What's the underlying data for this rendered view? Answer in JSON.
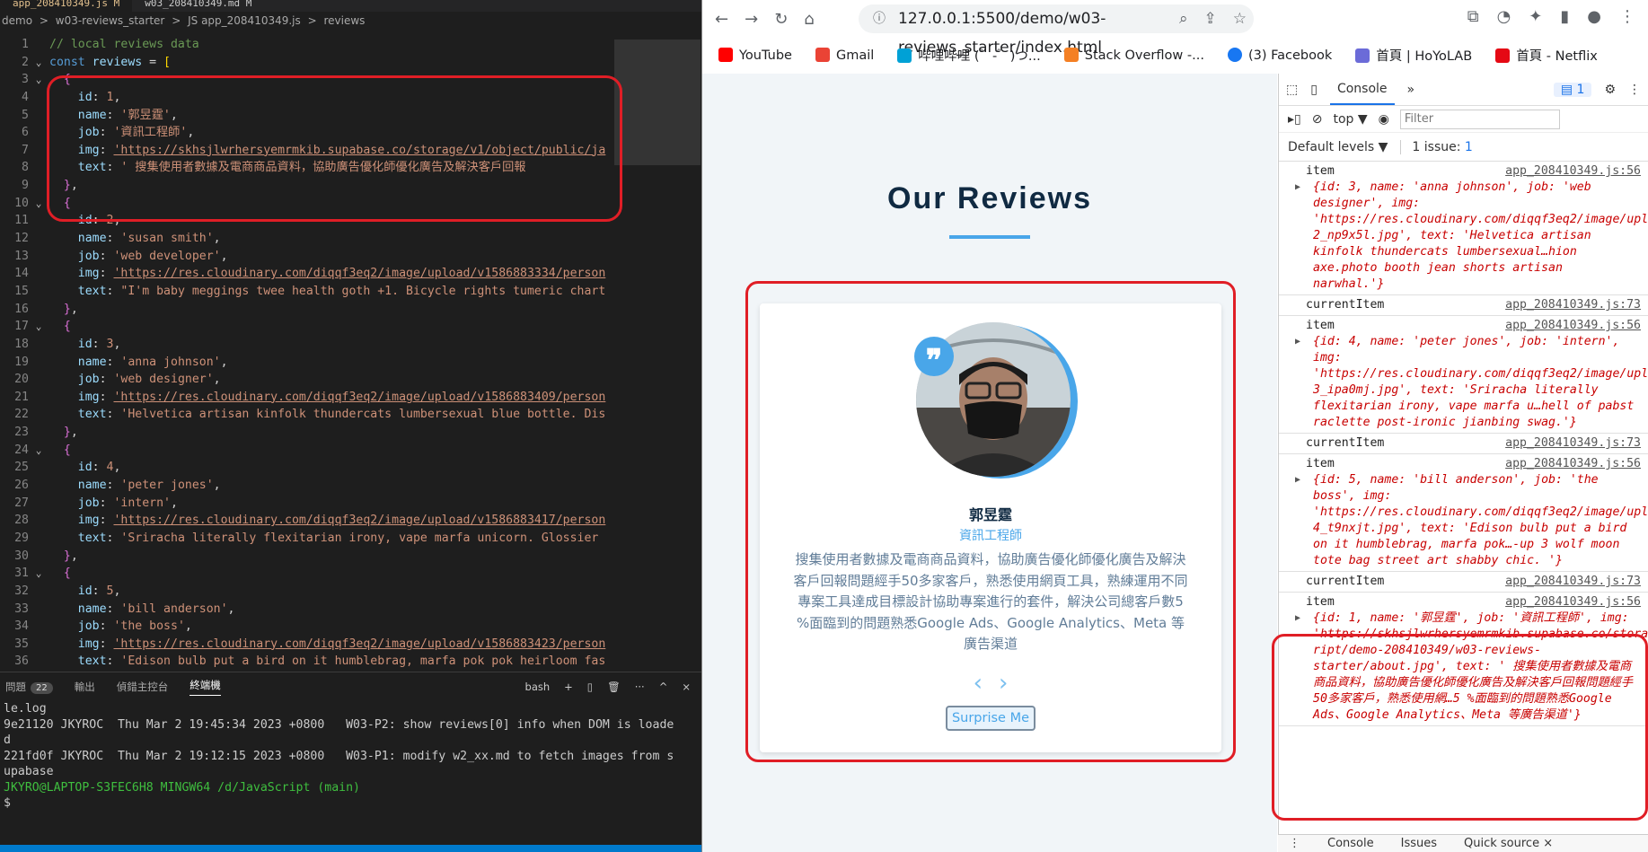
{
  "vscode": {
    "tabs": [
      "app_208410349.js M",
      "w03_208410349.md M"
    ],
    "breadcrumb": [
      "demo",
      ">",
      "w03-reviews_starter",
      ">",
      "JS app_208410349.js",
      ">",
      "reviews"
    ],
    "lines": [
      {
        "n": "1",
        "fold": "",
        "parts": [
          [
            "c",
            "// local reviews data"
          ]
        ]
      },
      {
        "n": "2",
        "fold": "v",
        "parts": [
          [
            "k",
            "const "
          ],
          [
            "v",
            "reviews"
          ],
          [
            "p",
            " = "
          ],
          [
            "b2",
            "["
          ]
        ]
      },
      {
        "n": "3",
        "fold": "v",
        "parts": [
          [
            "p",
            "  "
          ],
          [
            "b1",
            "{"
          ]
        ]
      },
      {
        "n": "4",
        "fold": "",
        "parts": [
          [
            "p",
            "    "
          ],
          [
            "v",
            "id"
          ],
          [
            "p",
            ": "
          ],
          [
            "s",
            "1"
          ],
          [
            "p",
            ","
          ]
        ]
      },
      {
        "n": "5",
        "fold": "",
        "parts": [
          [
            "p",
            "    "
          ],
          [
            "v",
            "name"
          ],
          [
            "p",
            ": "
          ],
          [
            "s",
            "'郭昱霆'"
          ],
          [
            "p",
            ","
          ]
        ]
      },
      {
        "n": "6",
        "fold": "",
        "parts": [
          [
            "p",
            "    "
          ],
          [
            "v",
            "job"
          ],
          [
            "p",
            ": "
          ],
          [
            "s",
            "'資訊工程師'"
          ],
          [
            "p",
            ","
          ]
        ]
      },
      {
        "n": "7",
        "fold": "",
        "parts": [
          [
            "p",
            "    "
          ],
          [
            "v",
            "img"
          ],
          [
            "p",
            ": "
          ],
          [
            "u",
            "'https://skhsjlwrhersyemrmkib.supabase.co/storage/v1/object/public/ja"
          ]
        ]
      },
      {
        "n": "8",
        "fold": "",
        "parts": [
          [
            "p",
            "    "
          ],
          [
            "v",
            "text"
          ],
          [
            "p",
            ": "
          ],
          [
            "s",
            "' 搜集使用者數據及電商商品資料，協助廣告優化師優化廣告及解決客戶回報"
          ]
        ]
      },
      {
        "n": "9",
        "fold": "",
        "parts": [
          [
            "p",
            "  "
          ],
          [
            "b1",
            "}"
          ],
          [
            "p",
            ","
          ]
        ]
      },
      {
        "n": "10",
        "fold": "v",
        "parts": [
          [
            "p",
            "  "
          ],
          [
            "b1",
            "{"
          ]
        ]
      },
      {
        "n": "11",
        "fold": "",
        "parts": [
          [
            "p",
            "    "
          ],
          [
            "v",
            "id"
          ],
          [
            "p",
            ": "
          ],
          [
            "s",
            "2"
          ],
          [
            "p",
            ","
          ]
        ]
      },
      {
        "n": "12",
        "fold": "",
        "parts": [
          [
            "p",
            "    "
          ],
          [
            "v",
            "name"
          ],
          [
            "p",
            ": "
          ],
          [
            "s",
            "'susan smith'"
          ],
          [
            "p",
            ","
          ]
        ]
      },
      {
        "n": "13",
        "fold": "",
        "parts": [
          [
            "p",
            "    "
          ],
          [
            "v",
            "job"
          ],
          [
            "p",
            ": "
          ],
          [
            "s",
            "'web developer'"
          ],
          [
            "p",
            ","
          ]
        ]
      },
      {
        "n": "14",
        "fold": "",
        "parts": [
          [
            "p",
            "    "
          ],
          [
            "v",
            "img"
          ],
          [
            "p",
            ": "
          ],
          [
            "u",
            "'https://res.cloudinary.com/diqqf3eq2/image/upload/v1586883334/person"
          ]
        ]
      },
      {
        "n": "15",
        "fold": "",
        "parts": [
          [
            "p",
            "    "
          ],
          [
            "v",
            "text"
          ],
          [
            "p",
            ": "
          ],
          [
            "s",
            "\"I'm baby meggings twee health goth +1. Bicycle rights tumeric chart"
          ]
        ]
      },
      {
        "n": "16",
        "fold": "",
        "parts": [
          [
            "p",
            "  "
          ],
          [
            "b1",
            "}"
          ],
          [
            "p",
            ","
          ]
        ]
      },
      {
        "n": "17",
        "fold": "v",
        "parts": [
          [
            "p",
            "  "
          ],
          [
            "b1",
            "{"
          ]
        ]
      },
      {
        "n": "18",
        "fold": "",
        "parts": [
          [
            "p",
            "    "
          ],
          [
            "v",
            "id"
          ],
          [
            "p",
            ": "
          ],
          [
            "s",
            "3"
          ],
          [
            "p",
            ","
          ]
        ]
      },
      {
        "n": "19",
        "fold": "",
        "parts": [
          [
            "p",
            "    "
          ],
          [
            "v",
            "name"
          ],
          [
            "p",
            ": "
          ],
          [
            "s",
            "'anna johnson'"
          ],
          [
            "p",
            ","
          ]
        ]
      },
      {
        "n": "20",
        "fold": "",
        "parts": [
          [
            "p",
            "    "
          ],
          [
            "v",
            "job"
          ],
          [
            "p",
            ": "
          ],
          [
            "s",
            "'web designer'"
          ],
          [
            "p",
            ","
          ]
        ]
      },
      {
        "n": "21",
        "fold": "",
        "parts": [
          [
            "p",
            "    "
          ],
          [
            "v",
            "img"
          ],
          [
            "p",
            ": "
          ],
          [
            "u",
            "'https://res.cloudinary.com/diqqf3eq2/image/upload/v1586883409/person"
          ]
        ]
      },
      {
        "n": "22",
        "fold": "",
        "parts": [
          [
            "p",
            "    "
          ],
          [
            "v",
            "text"
          ],
          [
            "p",
            ": "
          ],
          [
            "s",
            "'Helvetica artisan kinfolk thundercats lumbersexual blue bottle. Dis"
          ]
        ]
      },
      {
        "n": "23",
        "fold": "",
        "parts": [
          [
            "p",
            "  "
          ],
          [
            "b1",
            "}"
          ],
          [
            "p",
            ","
          ]
        ]
      },
      {
        "n": "24",
        "fold": "v",
        "parts": [
          [
            "p",
            "  "
          ],
          [
            "b1",
            "{"
          ]
        ]
      },
      {
        "n": "25",
        "fold": "",
        "parts": [
          [
            "p",
            "    "
          ],
          [
            "v",
            "id"
          ],
          [
            "p",
            ": "
          ],
          [
            "s",
            "4"
          ],
          [
            "p",
            ","
          ]
        ]
      },
      {
        "n": "26",
        "fold": "",
        "parts": [
          [
            "p",
            "    "
          ],
          [
            "v",
            "name"
          ],
          [
            "p",
            ": "
          ],
          [
            "s",
            "'peter jones'"
          ],
          [
            "p",
            ","
          ]
        ]
      },
      {
        "n": "27",
        "fold": "",
        "parts": [
          [
            "p",
            "    "
          ],
          [
            "v",
            "job"
          ],
          [
            "p",
            ": "
          ],
          [
            "s",
            "'intern'"
          ],
          [
            "p",
            ","
          ]
        ]
      },
      {
        "n": "28",
        "fold": "",
        "parts": [
          [
            "p",
            "    "
          ],
          [
            "v",
            "img"
          ],
          [
            "p",
            ": "
          ],
          [
            "u",
            "'https://res.cloudinary.com/diqqf3eq2/image/upload/v1586883417/person"
          ]
        ]
      },
      {
        "n": "29",
        "fold": "",
        "parts": [
          [
            "p",
            "    "
          ],
          [
            "v",
            "text"
          ],
          [
            "p",
            ": "
          ],
          [
            "s",
            "'Sriracha literally flexitarian irony, vape marfa unicorn. Glossier"
          ]
        ]
      },
      {
        "n": "30",
        "fold": "",
        "parts": [
          [
            "p",
            "  "
          ],
          [
            "b1",
            "}"
          ],
          [
            "p",
            ","
          ]
        ]
      },
      {
        "n": "31",
        "fold": "v",
        "parts": [
          [
            "p",
            "  "
          ],
          [
            "b1",
            "{"
          ]
        ]
      },
      {
        "n": "32",
        "fold": "",
        "parts": [
          [
            "p",
            "    "
          ],
          [
            "v",
            "id"
          ],
          [
            "p",
            ": "
          ],
          [
            "s",
            "5"
          ],
          [
            "p",
            ","
          ]
        ]
      },
      {
        "n": "33",
        "fold": "",
        "parts": [
          [
            "p",
            "    "
          ],
          [
            "v",
            "name"
          ],
          [
            "p",
            ": "
          ],
          [
            "s",
            "'bill anderson'"
          ],
          [
            "p",
            ","
          ]
        ]
      },
      {
        "n": "34",
        "fold": "",
        "parts": [
          [
            "p",
            "    "
          ],
          [
            "v",
            "job"
          ],
          [
            "p",
            ": "
          ],
          [
            "s",
            "'the boss'"
          ],
          [
            "p",
            ","
          ]
        ]
      },
      {
        "n": "35",
        "fold": "",
        "parts": [
          [
            "p",
            "    "
          ],
          [
            "v",
            "img"
          ],
          [
            "p",
            ": "
          ],
          [
            "u",
            "'https://res.cloudinary.com/diqqf3eq2/image/upload/v1586883423/person"
          ]
        ]
      },
      {
        "n": "36",
        "fold": "",
        "parts": [
          [
            "p",
            "    "
          ],
          [
            "v",
            "text"
          ],
          [
            "p",
            ": "
          ],
          [
            "s",
            "'Edison bulb put a bird on it humblebrag, marfa pok pok heirloom fas"
          ]
        ]
      }
    ],
    "panel_tabs": {
      "problems": "問題",
      "problems_count": "22",
      "output": "輸出",
      "debug": "偵錯主控台",
      "terminal": "終端機"
    },
    "panel_right": {
      "shell": "bash",
      "plus": "+",
      "split": "▯",
      "trash": "🗑",
      "more": "···",
      "up": "^",
      "close": "×"
    },
    "terminal": [
      "le.log",
      "9e21120 JKYROC  Thu Mar 2 19:45:34 2023 +0800   W03-P2: show reviews[0] info when DOM is loade",
      "d",
      "221fd0f JKYROC  Thu Mar 2 19:12:15 2023 +0800   W03-P1: modify w2_xx.md to fetch images from s",
      "upabase",
      "",
      "JKYRO@LAPTOP-S3FEC6H8 MINGW64 /d/JavaScript (main)",
      "$"
    ]
  },
  "browser": {
    "url": "127.0.0.1:5500/demo/w03-reviews_starter/index.html",
    "bookmarks": [
      {
        "label": "YouTube",
        "color": "#ff0000"
      },
      {
        "label": "Gmail",
        "color": "#ea4335"
      },
      {
        "label": "哔哩哔哩 (゜-゜)つ...",
        "color": "#00a1d6"
      },
      {
        "label": "Stack Overflow -...",
        "color": "#f48024"
      },
      {
        "label": "(3) Facebook",
        "color": "#1877f2"
      },
      {
        "label": "首頁 | HoYoLAB",
        "color": "#6b6bd8"
      },
      {
        "label": "首頁 - Netflix",
        "color": "#e50914"
      }
    ]
  },
  "page": {
    "title": "Our Reviews",
    "author": "郭昱霆",
    "job": "資訊工程師",
    "info": "搜集使用者數據及電商商品資料，協助廣告優化師優化廣告及解決客戶回報問題經手50多家客戶，熟悉使用網頁工具，熟練運用不同專案工具達成目標設計協助專案進行的套件，解決公司總客戶數5 %面臨到的問題熟悉Google Ads、Google Analytics、Meta 等廣告渠道",
    "prev": "‹",
    "next": "›",
    "surprise": "Surprise Me",
    "quote": "❞"
  },
  "devtools": {
    "tab_console": "Console",
    "more": "»",
    "msg_count": "1",
    "context": "top ▼",
    "filter_placeholder": "Filter",
    "levels": "Default levels ▼",
    "issues": "1 issue:",
    "issues_count": "1",
    "entries": [
      {
        "label": "item",
        "src": "app_208410349.js:56",
        "obj": "{id: 3, name: 'anna johnson', job: 'web designer', img: 'https://res.cloudinary.com/diqqf3eq2/image/upload/v1586883409/person-2_np9x5l.jpg', text: 'Helvetica artisan kinfolk thundercats lumbersexual…hion axe.photo booth jean shorts artisan narwhal.'}"
      },
      {
        "label": "currentItem",
        "src": "app_208410349.js:73",
        "obj": ""
      },
      {
        "label": "item",
        "src": "app_208410349.js:56",
        "obj": "{id: 4, name: 'peter jones', job: 'intern', img: 'https://res.cloudinary.com/diqqf3eq2/image/upload/v1586883417/person-3_ipa0mj.jpg', text: 'Sriracha literally flexitarian irony, vape marfa u…hell of pabst raclette post-ironic jianbing swag.'}"
      },
      {
        "label": "currentItem",
        "src": "app_208410349.js:73",
        "obj": ""
      },
      {
        "label": "item",
        "src": "app_208410349.js:56",
        "obj": "{id: 5, name: 'bill anderson', job: 'the boss', img: 'https://res.cloudinary.com/diqqf3eq2/image/upload/v1586883423/person-4_t9nxjt.jpg', text: 'Edison bulb put a bird on it humblebrag, marfa pok…-up 3 wolf moon tote bag street art shabby chic. '}"
      },
      {
        "label": "currentItem",
        "src": "app_208410349.js:73",
        "obj": ""
      },
      {
        "label": "item",
        "src": "app_208410349.js:56",
        "obj": "{id: 1, name: '郭昱霆', job: '資訊工程師', img: 'https://skhsjlwrhersyemrmkib.supabase.co/storage/v…ript/demo-208410349/w03-reviews-starter/about.jpg', text: ' 搜集使用者數據及電商商品資料，協助廣告優化師優化廣告及解決客戶回報問題經手50多家客戶，熟悉使用網…5 %面臨到的問題熟悉Google Ads、Google Analytics、Meta 等廣告渠道'}"
      }
    ],
    "prompt": "›",
    "bottom_tabs": [
      "Console",
      "Issues",
      "Quick source ×"
    ]
  }
}
